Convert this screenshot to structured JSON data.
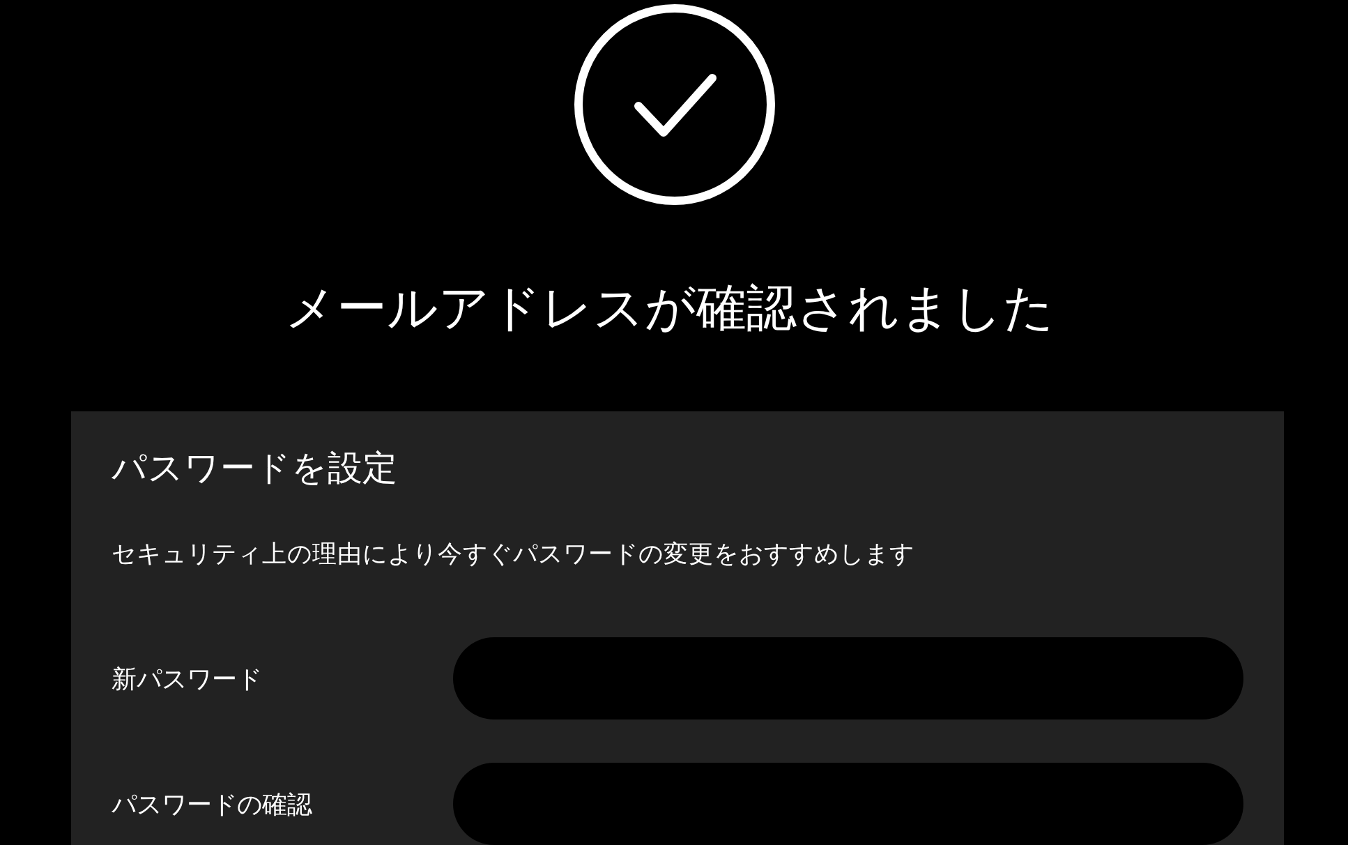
{
  "title": "メールアドレスが確認されました",
  "panel": {
    "heading": "パスワードを設定",
    "description": "セキュリティ上の理由により今すぐパスワードの変更をおすすめします",
    "fields": [
      {
        "label": "新パスワード"
      },
      {
        "label": "パスワードの確認"
      }
    ]
  }
}
